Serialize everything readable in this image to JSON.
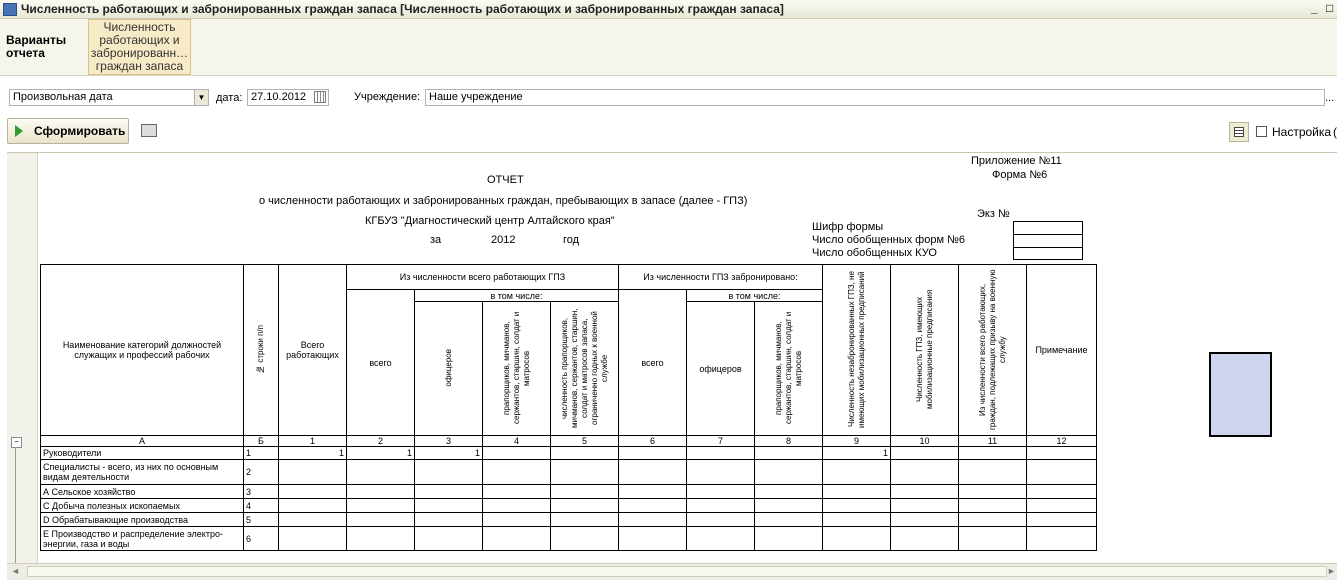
{
  "window": {
    "title": "Численность работающих и забронированных граждан запаса [Численность работающих и забронированных граждан запаса]",
    "min": "_",
    "close": "□"
  },
  "panel": {
    "variants_label": "Варианты отчета",
    "report_label": "Численность работающих и забронированн… граждан запаса"
  },
  "filters": {
    "period_value": "Произвольная дата",
    "date_label": "дата:",
    "date_value": "27.10.2012",
    "institution_label": "Учреждение:",
    "institution_value": "Наше учреждение",
    "more": "..."
  },
  "toolbar": {
    "form_button": "Сформировать",
    "settings_label": "Настройка",
    "paren": "("
  },
  "report": {
    "appendix": "Приложение №11",
    "form_no": "Форма №6",
    "title": "ОТЧЕТ",
    "subtitle": "о численности работающих и забронированных граждан, пребывающих в запасе (далее - ГПЗ)",
    "org": "КГБУЗ \"Диагностический центр Алтайского края\"",
    "za": "за",
    "year": "2012",
    "god": "год",
    "ekz": "Экз №",
    "cipher": "Шифр формы",
    "forms6": "Число обобщенных форм №6",
    "kuo": "Число обобщенных КУО",
    "headers": {
      "name": "Наименование категорий должностей служащих и профессий рабочих",
      "rowno": "№ строки п/п",
      "total": "Всего работающих",
      "group1": "Из численности всего работающих ГПЗ",
      "group2": "Из численности ГПЗ забронировано:",
      "vsego": "всего",
      "incl": "в том числе:",
      "officers": "офицеров",
      "praporshchiki": "прапорщиков, мичманов, сержантов, старшин, солдат и матросов",
      "limited": "численность прапорщиков, мичманов, сержантов, старшин, солдат и матросов запаса, ограниченно годных к военной службе",
      "vsego2": "всего",
      "incl2": "в том числе:",
      "officers2": "офицеров",
      "prap2": "прапорщиков, мичманов, сержантов, старшин, солдат и матросов",
      "col9": "Численность незабронированных ГПЗ, не имеющих мобилизационных предписаний",
      "col10": "Численность ГПЗ, имеющих мобилизационные предписания",
      "col11": "Из численности всего работающих, граждан, подлежащих призыву на военную службу",
      "col12": "Примечание"
    },
    "col_index": [
      "А",
      "Б",
      "1",
      "2",
      "3",
      "4",
      "5",
      "6",
      "7",
      "8",
      "9",
      "10",
      "11",
      "12"
    ],
    "rows": [
      {
        "name": "Руководители",
        "no": "1",
        "c1": "1",
        "c2": "1",
        "c3": "1",
        "c9": "1"
      },
      {
        "name": "Специалисты - всего, из них по основным видам деятельности",
        "no": "2"
      },
      {
        "name": "А Сельское хозяйство",
        "no": "3"
      },
      {
        "name": "С Добыча полезных ископаемых",
        "no": "4"
      },
      {
        "name": "D Обрабатывающие производства",
        "no": "5"
      },
      {
        "name": "Е Производство и распределение электро-энергии, газа и воды",
        "no": "6"
      }
    ]
  }
}
